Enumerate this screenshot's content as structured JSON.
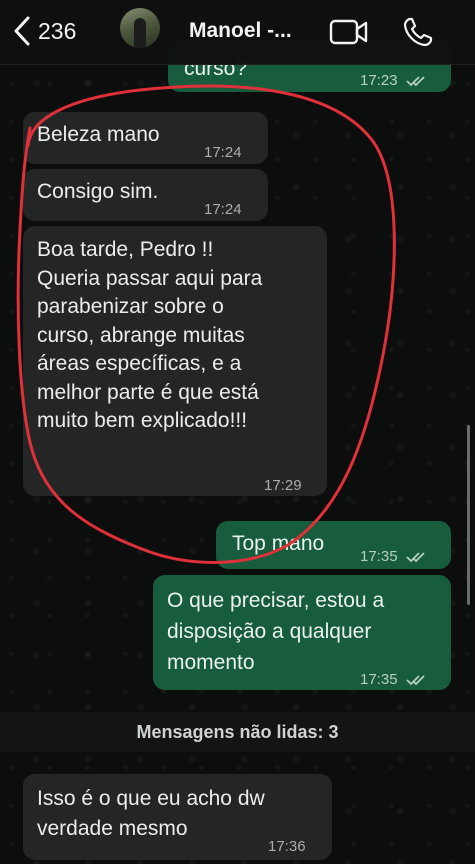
{
  "header": {
    "back_count": "236",
    "contact_name": "Manoel -..."
  },
  "messages": [
    {
      "direction": "out",
      "text": "curso?",
      "time": "17:23",
      "read": true
    },
    {
      "direction": "in",
      "text": "Beleza mano",
      "time": "17:24"
    },
    {
      "direction": "in",
      "text": "Consigo sim.",
      "time": "17:24"
    },
    {
      "direction": "in",
      "text": "Boa tarde, Pedro !!\nQueria passar aqui para\nparabenizar sobre o\ncurso, abrange muitas\náreas específicas, e a\nmelhor parte é que está\nmuito bem explicado!!!",
      "time": "17:29"
    },
    {
      "direction": "out",
      "text": "Top mano",
      "time": "17:35",
      "read": true
    },
    {
      "direction": "out",
      "text": "O que precisar, estou a\ndisposição a qualquer\nmomento",
      "time": "17:35",
      "read": true
    },
    {
      "direction": "in",
      "text": "Isso é o que eu acho dw\nverdade mesmo",
      "time": "17:36"
    }
  ],
  "unread_banner": "Mensagens não lidas: 3",
  "colors": {
    "incoming_bubble": "#242626",
    "outgoing_bubble": "#175c3c",
    "annotation_circle": "#e0303a",
    "read_ticks": "#b6d0c1"
  },
  "icons": [
    "chevron-left-icon",
    "video-call-icon",
    "phone-call-icon",
    "double-check-icon"
  ]
}
